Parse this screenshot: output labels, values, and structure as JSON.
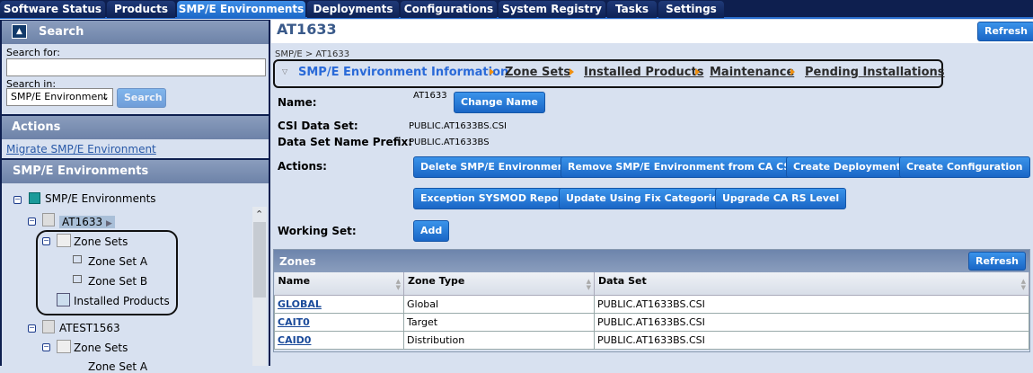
{
  "tabs": [
    "Software Status",
    "Products",
    "SMP/E Environments",
    "Deployments",
    "Configurations",
    "System Registry",
    "Tasks",
    "Settings"
  ],
  "active_tab": "SMP/E Environments",
  "search": {
    "title": "Search",
    "search_for_label": "Search for:",
    "search_for_value": "",
    "search_in_label": "Search in:",
    "search_in_value": "SMP/E Environment",
    "button": "Search"
  },
  "actions": {
    "title": "Actions",
    "link": "Migrate SMP/E Environment"
  },
  "tree": {
    "title": "SMP/E Environments",
    "root": "SMP/E Environments",
    "env1": "AT1633",
    "zone_sets": "Zone Sets",
    "zsa": "Zone Set A",
    "zsb": "Zone Set B",
    "installed": "Installed Products",
    "env2": "ATEST1563",
    "zone_sets2": "Zone Sets",
    "zsa2": "Zone Set A"
  },
  "main": {
    "title": "AT1633",
    "refresh": "Refresh",
    "breadcrumb": "SMP/E > AT1633",
    "nav": [
      "SMP/E Environment Information",
      "Zone Sets",
      "Installed Products",
      "Maintenance",
      "Pending Installations"
    ],
    "name_label": "Name:",
    "name_value": "AT1633",
    "change_name": "Change Name",
    "csi_label": "CSI Data Set:",
    "csi_value": "PUBLIC.AT1633BS.CSI",
    "prefix_label": "Data Set Name Prefix:",
    "prefix_value": "PUBLIC.AT1633BS",
    "actions_label": "Actions:",
    "action_buttons": [
      "Delete SMP/E Environment",
      "Remove SMP/E Environment from CA CSM",
      "Create Deployment",
      "Create Configuration",
      "Exception SYSMOD Report",
      "Update Using Fix Categories",
      "Upgrade CA RS Level"
    ],
    "working_set_label": "Working Set:",
    "add": "Add"
  },
  "zones": {
    "title": "Zones",
    "refresh": "Refresh",
    "columns": [
      "Name",
      "Zone Type",
      "Data Set"
    ],
    "rows": [
      [
        "GLOBAL",
        "Global",
        "PUBLIC.AT1633BS.CSI"
      ],
      [
        "CAIT0",
        "Target",
        "PUBLIC.AT1633BS.CSI"
      ],
      [
        "CAID0",
        "Distribution",
        "PUBLIC.AT1633BS.CSI"
      ]
    ]
  }
}
